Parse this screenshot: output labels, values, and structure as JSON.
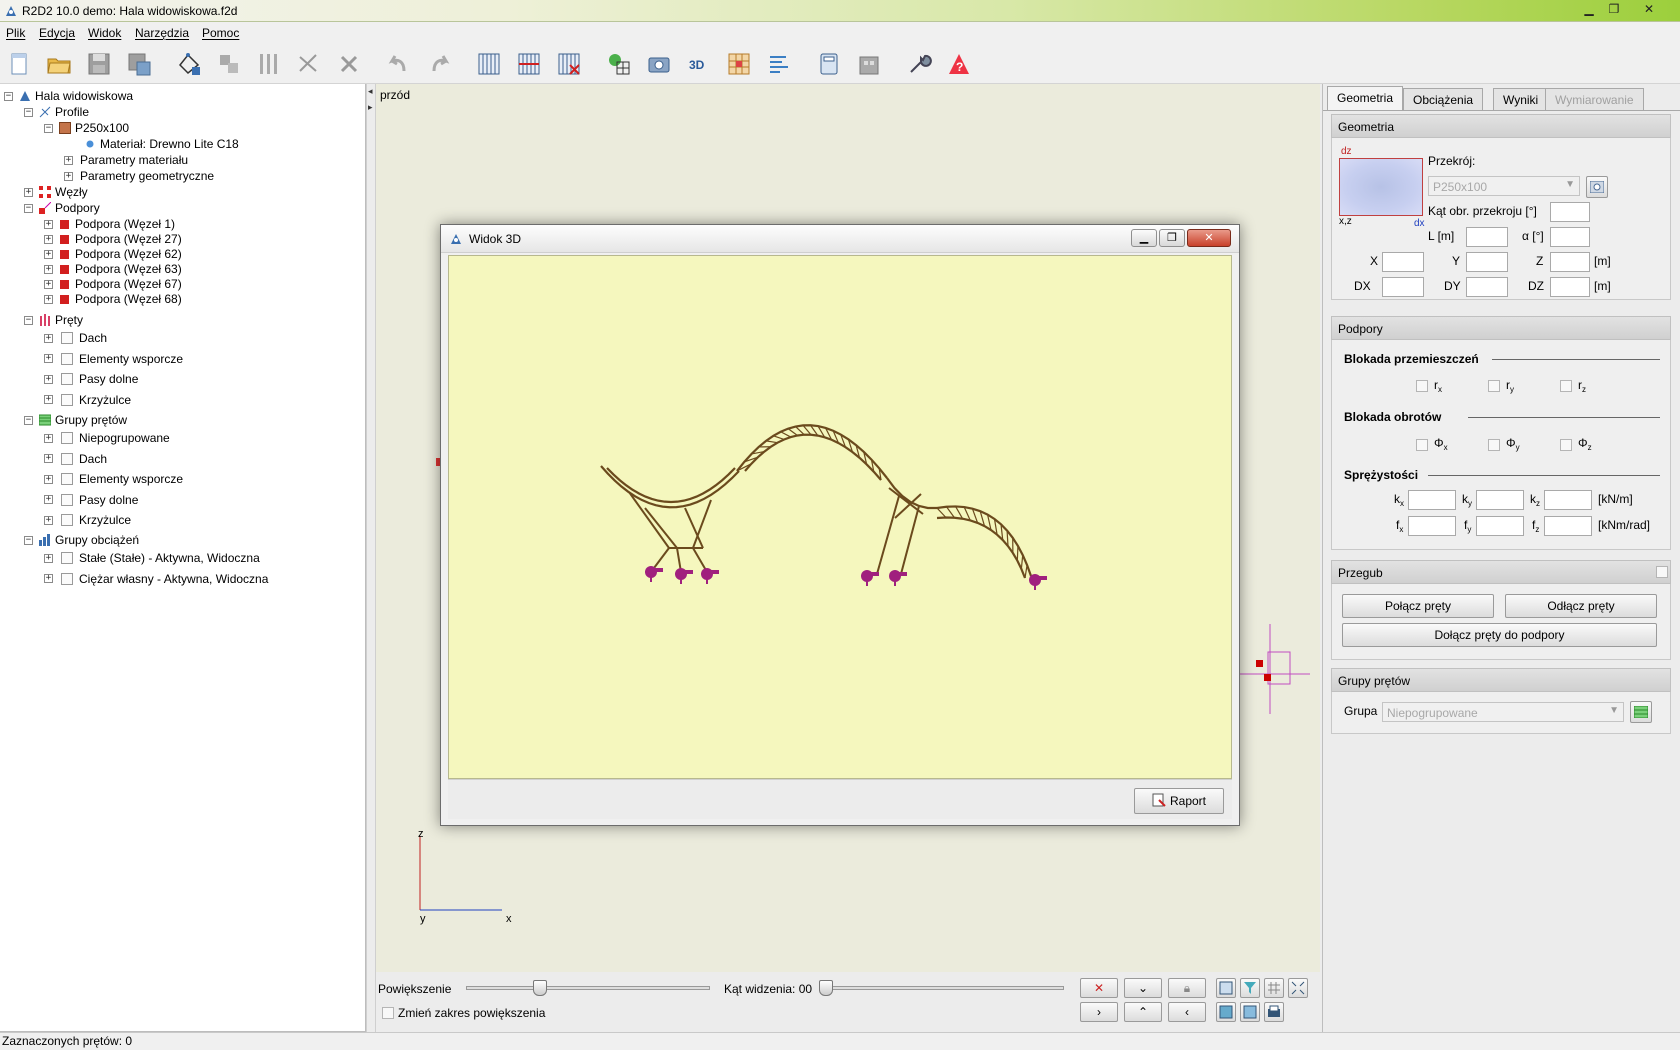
{
  "window": {
    "title": "R2D2 10.0 demo: Hala widowiskowa.f2d",
    "minimize": "▁",
    "maximize": "❐",
    "close": "✕"
  },
  "menu": [
    "Plik",
    "Edycja",
    "Widok",
    "Narzędzia",
    "Pomoc"
  ],
  "toolbar_icons": [
    "new-file-icon",
    "open-folder-icon",
    "save-icon",
    "save-as-icon",
    "add-node-icon",
    "copy-icon",
    "columns-icon",
    "scissors-icon",
    "delete-icon",
    "undo-icon",
    "redo-icon",
    "grid-view-icon",
    "grid-red-icon",
    "grid-delete-icon",
    "calc-model-icon",
    "camera-icon",
    "3d-icon",
    "mesh-icon",
    "align-icon",
    "calculator-icon",
    "building-icon",
    "wrench-icon",
    "help-icon"
  ],
  "tree": {
    "root": "Hala widowiskowa",
    "profile": "Profile",
    "profile_item": "P250x100",
    "material": "Materiał: Drewno Lite C18",
    "material_params": "Parametry materiału",
    "geom_params": "Parametry geometryczne",
    "nodes": "Węzły",
    "supports": "Podpory",
    "support_items": [
      "Podpora (Węzeł 1)",
      "Podpora (Węzeł 27)",
      "Podpora (Węzeł 62)",
      "Podpora (Węzeł 63)",
      "Podpora (Węzeł 67)",
      "Podpora (Węzeł 68)"
    ],
    "bars": "Pręty",
    "bar_items": [
      "Dach",
      "Elementy wsporcze",
      "Pasy dolne",
      "Krzyżulce"
    ],
    "bar_groups": "Grupy prętów",
    "bar_group_items": [
      "Niepogrupowane",
      "Dach",
      "Elementy wsporcze",
      "Pasy dolne",
      "Krzyżulce"
    ],
    "load_groups": "Grupy obciążeń",
    "load_group_items": [
      "Stałe (Stałe) - Aktywna, Widoczna",
      "Ciężar własny - Aktywna, Widoczna"
    ]
  },
  "canvas": {
    "view_label": "przód",
    "axis_z": "z",
    "axis_y": "y",
    "axis_x": "x"
  },
  "dialog": {
    "title": "Widok 3D",
    "report_button": "Raport",
    "minimize": "▁",
    "maximize": "❐",
    "close": "✕"
  },
  "bottom": {
    "zoom_label": "Powiększenie",
    "zoom_value": 0.29,
    "angle_label": "Kąt widzenia: 00",
    "angle_value": 0.0,
    "zoom_range_label": "Zmień zakres powiększenia"
  },
  "right_panel": {
    "tabs": [
      "Geometria",
      "Obciążenia",
      "Wyniki",
      "Wymiarowanie"
    ],
    "geometria": {
      "header": "Geometria",
      "przekroj_label": "Przekrój:",
      "przekroj_value": "P250x100",
      "dz": "dz",
      "xz": "x,z",
      "dx": "dx",
      "kat_label": "Kąt obr. przekroju [°]",
      "L_label": "L [m]",
      "alpha_label": "α [°]",
      "X": "X",
      "Y": "Y",
      "Z": "Z",
      "m1": "[m]",
      "DX": "DX",
      "DY": "DY",
      "DZ": "DZ",
      "m2": "[m]"
    },
    "podpory": {
      "header": "Podpory",
      "blokada_przem": "Blokada przemieszczeń",
      "blokada_obr": "Blokada obrotów",
      "sprezystosci": "Sprężystości",
      "r": "r",
      "phi": "Φ",
      "sub_x": "x",
      "sub_y": "y",
      "sub_z": "z",
      "k": "k",
      "f": "f",
      "unit_kn_m": "[kN/m]",
      "unit_knm_rad": "[kNm/rad]"
    },
    "przegub": {
      "header": "Przegub",
      "polacz": "Połącz pręty",
      "odlacz": "Odłącz pręty",
      "dolacz": "Dołącz pręty do podpory"
    },
    "grupy": {
      "header": "Grupy prętów",
      "grupa_label": "Grupa",
      "grupa_value": "Niepogrupowane"
    }
  },
  "status": "Zaznaczonych prętów: 0",
  "colors": {
    "structure": "#6b4a1d",
    "supports": "#a0207e",
    "viewport_bg": "#f5f7be"
  }
}
